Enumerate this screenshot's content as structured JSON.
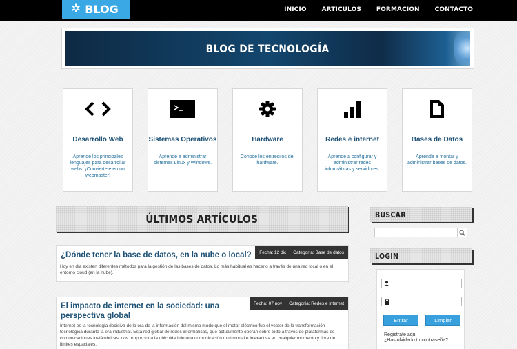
{
  "header": {
    "logo_text": "BLOG",
    "logo_icon": "gear-icon",
    "nav": [
      "INICIO",
      "ARTICULOS",
      "FORMACION",
      "CONTACTO"
    ]
  },
  "banner": {
    "title": "BLOG DE TECNOLOGÍA"
  },
  "categories": [
    {
      "icon": "code-icon",
      "title": "Desarrollo Web",
      "desc": "Aprende los principales lenguajes para desarrollar webs. ¡Conviertete en un webmaster!"
    },
    {
      "icon": "terminal-icon",
      "title": "Sistemas Operativos",
      "desc": "Aprende a administrar sistemas Linux y Windows."
    },
    {
      "icon": "gear-icon",
      "title": "Hardware",
      "desc": "Conoce los entresijos del hardware."
    },
    {
      "icon": "signal-bars-icon",
      "title": "Redes e internet",
      "desc": "Aprende a configurar y administrar redes informáticas y servidores."
    },
    {
      "icon": "document-icon",
      "title": "Bases de Datos",
      "desc": "Aprende a montar y administrar bases de datos."
    }
  ],
  "articles_section": {
    "title": "ÚLTIMOS ARTÍCULOS"
  },
  "articles": [
    {
      "title": "¿Dónde tener la base de datos, en la nube o local?",
      "date": "Fecha: 12 dic",
      "category": "Categoría: Base de datos",
      "body": "Hoy en día existen diferentes métodos para la gestión de las bases de datos. Lo más habitual es hacerlo a través de una red local o en el entorno cloud (en la nube)."
    },
    {
      "title": "El impacto de internet en la sociedad: una perspectiva global",
      "date": "Fecha: 07 nov",
      "category": "Categoría: Redes e internet",
      "body": "Internet es la tecnología decisiva de la era de la información del mismo modo que el motor eléctrico fue el vector de la transformación tecnológica durante la era industrial. Esta red global de redes informáticas, que actualmente operan sobre todo a través de plataformas de comunicaciones inalámbricas, nos proporciona la ubicuidad de una comunicación multimodal e interactiva en cualquier momento y libre de límites espaciales."
    }
  ],
  "sidebar": {
    "search_title": "BUSCAR",
    "search_placeholder": "",
    "login_title": "LOGIN",
    "user_placeholder": "",
    "pass_placeholder": "",
    "enter_label": "Entrar",
    "clear_label": "Limpiar",
    "register_link": "Registrate aquí",
    "forgot_link": "¿Has olvidado tu contraseña?"
  },
  "colors": {
    "accent": "#3aa8e4",
    "link": "#1f5276",
    "nav_bg": "#000000"
  }
}
